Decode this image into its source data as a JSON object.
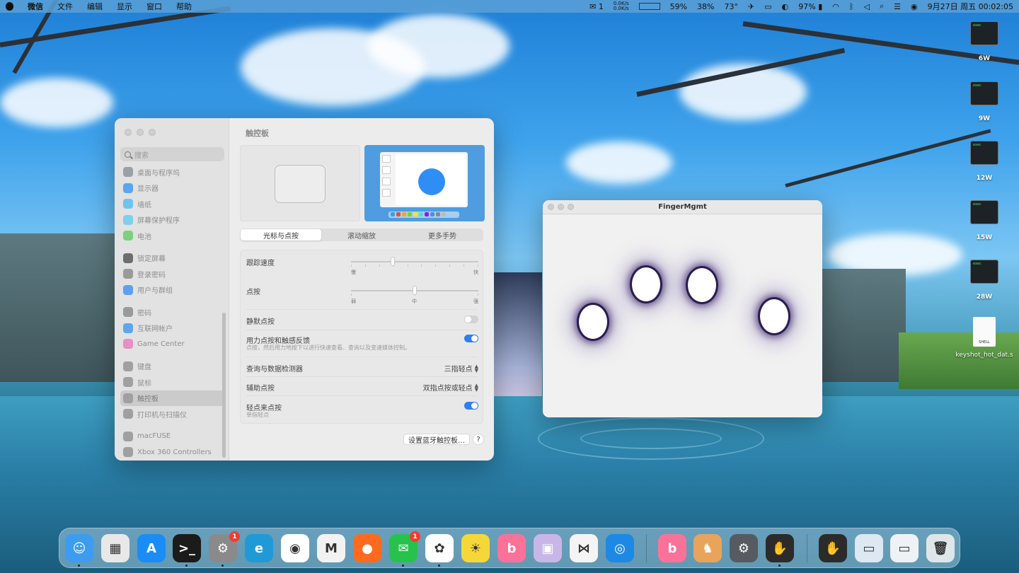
{
  "menubar": {
    "app": "微信",
    "menus": [
      "文件",
      "编辑",
      "显示",
      "窗口",
      "帮助"
    ],
    "wechat_count": "1",
    "net_up": "0.0K/s",
    "net_down": "0.0K/s",
    "mem": "59%",
    "cpu": "38%",
    "temp": "73°",
    "battery": "97%",
    "datetime": "9月27日 周五 00:02:05"
  },
  "settings": {
    "title": "触控板",
    "search_placeholder": "搜索",
    "sidebar": [
      {
        "label": "桌面与程序坞",
        "color": "#9ba0a6"
      },
      {
        "label": "显示器",
        "color": "#5aa6f0"
      },
      {
        "label": "墙纸",
        "color": "#6fc4ee"
      },
      {
        "label": "屏幕保护程序",
        "color": "#7fd0e8"
      },
      {
        "label": "电池",
        "color": "#7ed07a"
      },
      {
        "label": "锁定屏幕",
        "color": "#6d6d6d"
      },
      {
        "label": "登录密码",
        "color": "#9a9a9a"
      },
      {
        "label": "用户与群组",
        "color": "#5e9ff0"
      },
      {
        "label": "密码",
        "color": "#9a9a9a"
      },
      {
        "label": "互联网帐户",
        "color": "#5ea6f0"
      },
      {
        "label": "Game Center",
        "color": "#e88fc4"
      },
      {
        "label": "键盘",
        "color": "#a0a0a0"
      },
      {
        "label": "鼠标",
        "color": "#a0a0a0"
      },
      {
        "label": "触控板",
        "color": "#a0a0a0"
      },
      {
        "label": "打印机与扫描仪",
        "color": "#a0a0a0"
      },
      {
        "label": "macFUSE",
        "color": "#a0a0a0"
      },
      {
        "label": "Xbox 360 Controllers",
        "color": "#a0a0a0"
      }
    ],
    "tabs": [
      "光标与点按",
      "滚动缩放",
      "更多手势"
    ],
    "tracking": {
      "label": "跟踪速度",
      "min": "慢",
      "max": "快",
      "value": 0.33
    },
    "click": {
      "label": "点按",
      "min": "弱",
      "mid": "中",
      "max": "强",
      "value": 0.5
    },
    "silent_click": {
      "label": "静默点按",
      "on": false
    },
    "force_click": {
      "label": "用力点按和触感反馈",
      "sub": "点按，然后用力地按下以进行快速查看、查询以及变速媒体控制。",
      "on": true
    },
    "lookup": {
      "label": "查询与数据检测器",
      "value": "三指轻点"
    },
    "secondary": {
      "label": "辅助点按",
      "value": "双指点按或轻点"
    },
    "tap": {
      "label": "轻点来点按",
      "sub": "单指轻点",
      "on": true
    },
    "bt_button": "设置蓝牙触控板…",
    "help": "?"
  },
  "finger": {
    "title": "FingerMgmt"
  },
  "desktop": {
    "exec_label": "exec",
    "watts": [
      "6W",
      "9W",
      "12W",
      "15W",
      "28W"
    ],
    "shell_icon": "SHELL",
    "shell_name": "keyshot_hot_dat.s"
  },
  "dock": {
    "wechat_badge": "1",
    "settings_badge": "1",
    "apps": [
      {
        "name": "finder",
        "color": "#3c9cf0",
        "glyph": "☺"
      },
      {
        "name": "launchpad",
        "color": "#e8e8e8",
        "glyph": "▦"
      },
      {
        "name": "app-store",
        "color": "#1a8cf5",
        "glyph": "A"
      },
      {
        "name": "terminal",
        "color": "#1b1b1b",
        "glyph": ">_"
      },
      {
        "name": "system-settings",
        "color": "#8a8a8a",
        "glyph": "⚙"
      },
      {
        "name": "edge",
        "color": "#1f9ad6",
        "glyph": "e"
      },
      {
        "name": "chrome",
        "color": "#ffffff",
        "glyph": "◉"
      },
      {
        "name": "mail-m",
        "color": "#f2f2f2",
        "glyph": "M"
      },
      {
        "name": "firefox",
        "color": "#ff6a1f",
        "glyph": "●"
      },
      {
        "name": "wechat",
        "color": "#27c24c",
        "glyph": "✉"
      },
      {
        "name": "qq",
        "color": "#ffffff",
        "glyph": "✿"
      },
      {
        "name": "app-yellow",
        "color": "#f6d73a",
        "glyph": "☀"
      },
      {
        "name": "bilibili",
        "color": "#fb7299",
        "glyph": "b"
      },
      {
        "name": "disk-app",
        "color": "#c9b6e8",
        "glyph": "▣"
      },
      {
        "name": "vscode",
        "color": "#f4f4f4",
        "glyph": "⋈"
      },
      {
        "name": "maps-pin",
        "color": "#1e88e5",
        "glyph": "◎"
      },
      {
        "name": "bilibili-2",
        "color": "#fb7299",
        "glyph": "b"
      },
      {
        "name": "chicken-app",
        "color": "#e8a45a",
        "glyph": "♞"
      },
      {
        "name": "gear-app",
        "color": "#555b60",
        "glyph": "⚙"
      },
      {
        "name": "hand-app",
        "color": "#2b2b2b",
        "glyph": "✋"
      },
      {
        "name": "hand-app-2",
        "color": "#2b2b2b",
        "glyph": "✋"
      },
      {
        "name": "window-preview",
        "color": "#dde8f2",
        "glyph": "▭"
      },
      {
        "name": "window-preview-2",
        "color": "#eef2f4",
        "glyph": "▭"
      },
      {
        "name": "trash",
        "color": "#dfe6ea",
        "glyph": "🗑"
      }
    ]
  }
}
